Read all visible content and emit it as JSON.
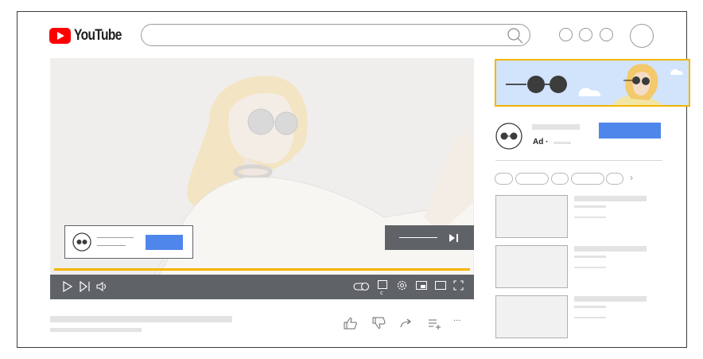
{
  "header": {
    "logo_text": "YouTube",
    "logo_icon": "youtube-play-icon",
    "search_placeholder": "",
    "search_icon": "search-icon"
  },
  "player": {
    "skip_icon": "skip-ad-icon",
    "overlay_ad_button_label": "",
    "progress_color": "#f3b500",
    "controls": [
      "play-icon",
      "next-icon",
      "volume-icon",
      "autoplay-toggle-icon",
      "captions-icon",
      "settings-icon",
      "miniplayer-icon",
      "theater-icon",
      "fullscreen-icon"
    ],
    "captions_label": "c"
  },
  "companion_ad": {
    "ad_label": "Ad ·",
    "cta_color": "#4f86ec",
    "banner_border_color": "#f3b500"
  },
  "actions": [
    "like-icon",
    "dislike-icon",
    "share-icon",
    "add-to-playlist-icon",
    "more-icon"
  ],
  "more_label": "···",
  "chips_chevron": "›"
}
